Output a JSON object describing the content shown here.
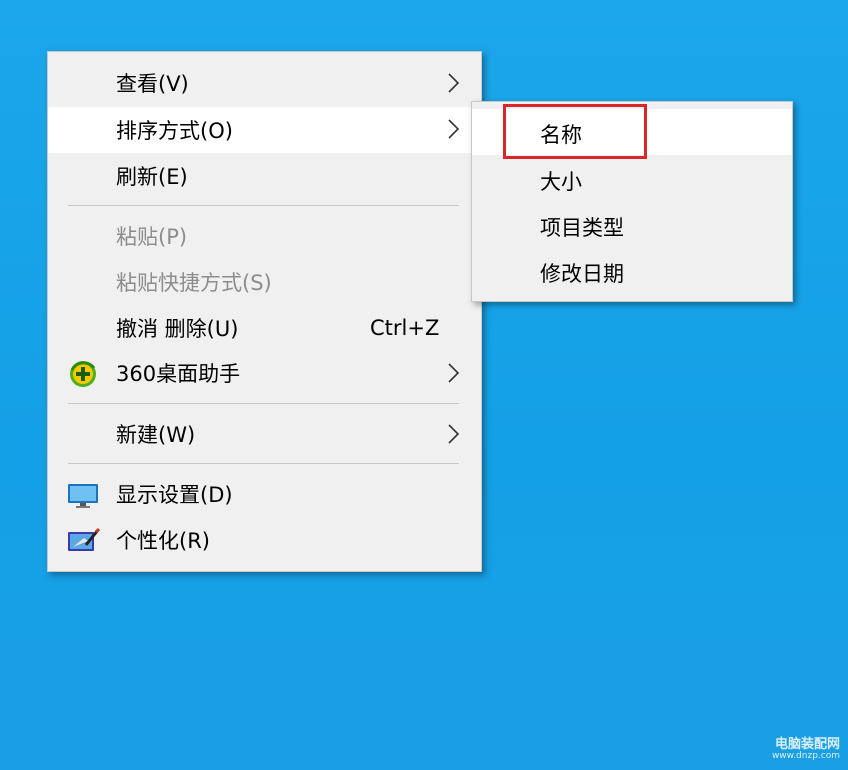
{
  "context_menu": {
    "items": [
      {
        "label": "查看(V)"
      },
      {
        "label": "排序方式(O)"
      },
      {
        "label": "刷新(E)"
      },
      {
        "label": "粘贴(P)"
      },
      {
        "label": "粘贴快捷方式(S)"
      },
      {
        "label": "撤消 删除(U)",
        "shortcut": "Ctrl+Z"
      },
      {
        "label": "360桌面助手"
      },
      {
        "label": "新建(W)"
      },
      {
        "label": "显示设置(D)"
      },
      {
        "label": "个性化(R)"
      }
    ]
  },
  "sort_submenu": {
    "items": [
      {
        "label": "名称"
      },
      {
        "label": "大小"
      },
      {
        "label": "项目类型"
      },
      {
        "label": "修改日期"
      }
    ]
  },
  "icons": {
    "assistant": "360-assistant-icon",
    "display": "monitor-icon",
    "personalize": "personalize-icon",
    "submenu_arrow": "chevron-right-icon"
  },
  "colors": {
    "desktop": "#1aa3e8",
    "menu_bg": "#f0f0f0",
    "hover_bg": "#ffffff",
    "disabled_text": "#8d8d8d",
    "highlight_box": "#d9262a"
  },
  "watermark": {
    "title": "电脑装配网",
    "url": "www.dnzp.com"
  }
}
